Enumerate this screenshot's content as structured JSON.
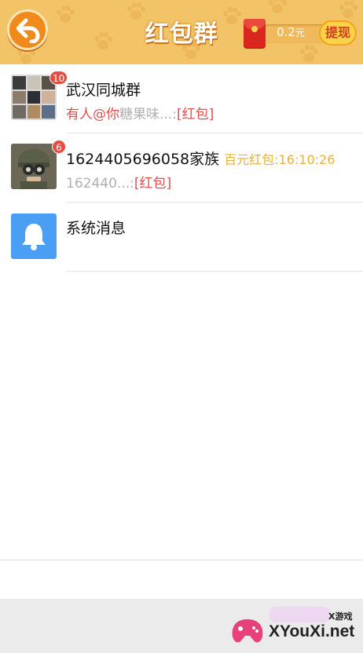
{
  "header": {
    "title": "红包群",
    "balance_value": "0.2",
    "balance_unit": "元",
    "withdraw_label": "提现",
    "background_color": "#f2c467"
  },
  "chats": [
    {
      "name": "武汉同城群",
      "badge": "10",
      "preview_mention": "有人@你",
      "preview_text": "糖果味...:",
      "preview_tag": "[红包]"
    },
    {
      "name": "1624405696058家族",
      "badge": "6",
      "highlight": "百元红包:16:10:26",
      "preview_text": "162440...:",
      "preview_tag": "[红包]"
    },
    {
      "name": "系统消息",
      "icon": "bell-icon"
    }
  ],
  "watermark": {
    "text": "XYouXi.net",
    "small": "X游戏"
  },
  "colors": {
    "mention": "#e0504f",
    "muted": "#b0b0b0",
    "tag": "#e0504f",
    "highlight": "#e8b23a",
    "bell_bg": "#4a9ef3"
  }
}
